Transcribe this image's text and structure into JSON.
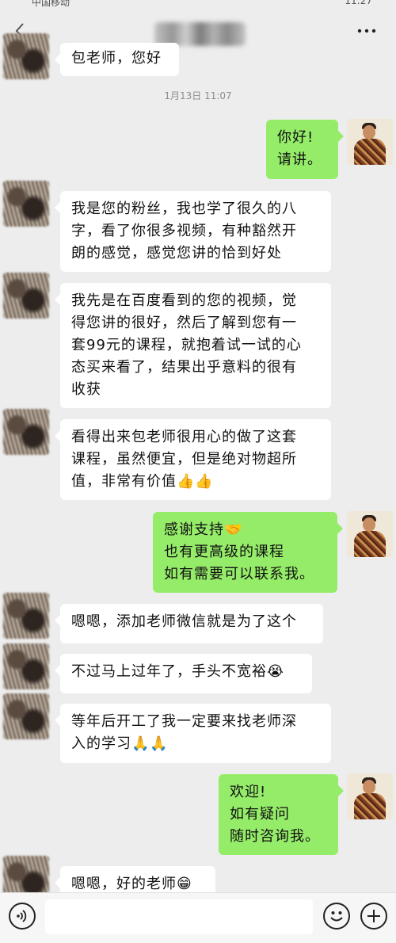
{
  "status_bar": {
    "left_text": "中国移动",
    "right_text": "11:27"
  },
  "header": {
    "back_icon": "chevron-left-icon",
    "more_icon": "more-dots-icon"
  },
  "timestamp": "1月13日 11:07",
  "messages": [
    {
      "side": "in",
      "lines": [
        "包老师，您好"
      ]
    },
    {
      "side": "out",
      "lines": [
        "你好!",
        "请讲。"
      ]
    },
    {
      "side": "in",
      "lines": [
        "我是您的粉丝，我也学了很久的八",
        "字，看了你很多视频，有种豁然开",
        "朗的感觉，感觉您讲的恰到好处"
      ]
    },
    {
      "side": "in",
      "lines": [
        "我先是在百度看到的您的视频，觉",
        "得您讲的很好，然后了解到您有一",
        "套99元的课程，就抱着试一试的心",
        "态买来看了，结果出乎意料的很有",
        "收获"
      ]
    },
    {
      "side": "in",
      "lines": [
        "看得出来包老师很用心的做了这套",
        "课程，虽然便宜，但是绝对物超所",
        "值，非常有价值👍👍"
      ]
    },
    {
      "side": "out",
      "lines": [
        "感谢支持🤝",
        "也有更高级的课程",
        "如有需要可以联系我。"
      ]
    },
    {
      "side": "in",
      "lines": [
        "嗯嗯，添加老师微信就是为了这个"
      ]
    },
    {
      "side": "in",
      "lines": [
        "不过马上过年了，手头不宽裕😭"
      ]
    },
    {
      "side": "in",
      "lines": [
        "等年后开工了我一定要来找老师深",
        "入的学习🙏🙏"
      ]
    },
    {
      "side": "out",
      "lines": [
        "欢迎!",
        "如有疑问",
        "随时咨询我。"
      ]
    },
    {
      "side": "in",
      "lines": [
        "嗯嗯，好的老师😁"
      ]
    }
  ],
  "input_bar": {
    "voice_icon": "voice-icon",
    "emoji_icon": "emoji-icon",
    "plus_icon": "plus-icon",
    "input_value": ""
  }
}
